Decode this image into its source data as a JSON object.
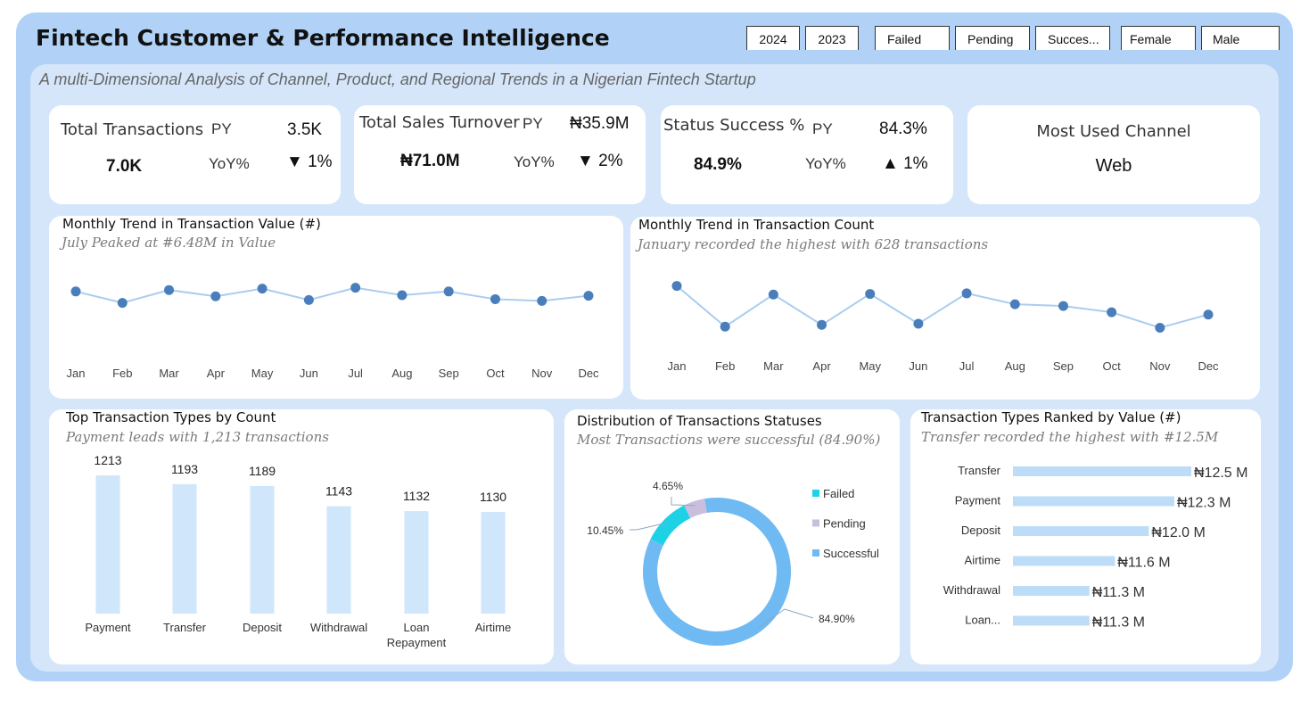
{
  "header": {
    "title": "Fintech Customer & Performance Intelligence",
    "subtitle": "A multi-Dimensional Analysis of Channel, Product, and Regional Trends in a Nigerian Fintech Startup"
  },
  "slicers": {
    "year": [
      "2024",
      "2023"
    ],
    "status": [
      "Failed",
      "Pending",
      "Succes..."
    ],
    "gender": [
      "Female",
      "Male"
    ]
  },
  "kpis": {
    "transactions": {
      "label": "Total Transactions",
      "value": "7.0K",
      "py_label": "PY",
      "py": "3.5K",
      "yoy_label": "YoY%",
      "yoy": "▼ 1%"
    },
    "turnover": {
      "label": "Total Sales Turnover",
      "value": "₦71.0M",
      "py_label": "PY",
      "py": "₦35.9M",
      "yoy_label": "YoY%",
      "yoy": "▼ 2%"
    },
    "success": {
      "label": "Status Success %",
      "value": "84.9%",
      "py_label": "PY",
      "py": "84.3%",
      "yoy_label": "YoY%",
      "yoy": "▲ 1%"
    },
    "channel": {
      "label": "Most Used Channel",
      "value": "Web"
    }
  },
  "chart_data": [
    {
      "id": "value_trend",
      "type": "line",
      "title": "Monthly Trend in Transaction Value (#)",
      "subtitle": "July Peaked at #6.48M in Value",
      "categories": [
        "Jan",
        "Feb",
        "Mar",
        "Apr",
        "May",
        "Jun",
        "Jul",
        "Aug",
        "Sep",
        "Oct",
        "Nov",
        "Dec"
      ],
      "values": [
        6.35,
        5.95,
        6.4,
        6.18,
        6.45,
        6.05,
        6.48,
        6.22,
        6.35,
        6.08,
        6.02,
        6.2
      ],
      "ylim": [
        5.0,
        7.5
      ],
      "color": "#4a7ebb",
      "line_color": "#a9cdf0"
    },
    {
      "id": "count_trend",
      "type": "line",
      "title": "Monthly Trend in Transaction Count",
      "subtitle": "January recorded the highest with 628 transactions",
      "categories": [
        "Jan",
        "Feb",
        "Mar",
        "Apr",
        "May",
        "Jun",
        "Jul",
        "Aug",
        "Sep",
        "Oct",
        "Nov",
        "Dec"
      ],
      "values": [
        628,
        557,
        613,
        560,
        614,
        562,
        615,
        596,
        593,
        582,
        555,
        578
      ],
      "ylim": [
        520,
        660
      ],
      "color": "#4a7ebb",
      "line_color": "#a9cdf0"
    },
    {
      "id": "type_count",
      "type": "bar",
      "title": "Top Transaction Types by Count",
      "subtitle": "Payment leads with 1,213 transactions",
      "categories": [
        "Payment",
        "Transfer",
        "Deposit",
        "Withdrawal",
        "Loan Repayment",
        "Airtime"
      ],
      "values": [
        1213,
        1193,
        1189,
        1143,
        1132,
        1130
      ],
      "ylim": [
        900,
        1250
      ],
      "color": "#cfe6fb"
    },
    {
      "id": "status_dist",
      "type": "pie",
      "title": "Distribution of Transactions Statuses",
      "subtitle": "Most Transactions were successful (84.90%)",
      "labels": [
        "Failed",
        "Pending",
        "Successful"
      ],
      "values": [
        10.45,
        4.65,
        84.9
      ],
      "data_labels": [
        "10.45%",
        "4.65%",
        "84.90%"
      ],
      "colors": [
        "#1ed2e6",
        "#c9bfdd",
        "#6fbaf2"
      ],
      "legend": "right"
    },
    {
      "id": "type_value",
      "type": "bar",
      "orientation": "horizontal",
      "title": "Transaction Types Ranked by Value (#)",
      "subtitle": "Transfer recorded the highest with #12.5M",
      "categories": [
        "Transfer",
        "Payment",
        "Deposit",
        "Airtime",
        "Withdrawal",
        "Loan..."
      ],
      "values": [
        12.5,
        12.3,
        12.0,
        11.6,
        11.3,
        11.3
      ],
      "data_labels": [
        "₦12.5 M",
        "₦12.3 M",
        "₦12.0 M",
        "₦11.6 M",
        "₦11.3 M",
        "₦11.3 M"
      ],
      "xlim": [
        10.4,
        12.5
      ],
      "color": "#bcdcf7"
    }
  ]
}
